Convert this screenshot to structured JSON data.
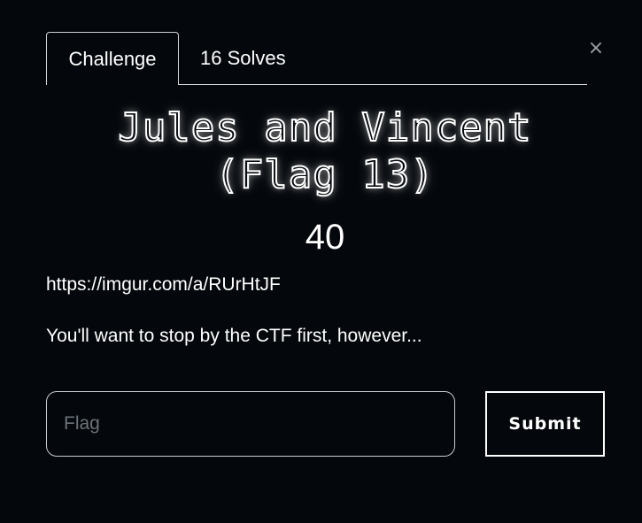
{
  "modal": {
    "close_glyph": "×",
    "tabs": [
      {
        "label": "Challenge",
        "active": true
      },
      {
        "label": "16 Solves",
        "active": false
      }
    ],
    "title_line1": "Jules and Vincent",
    "title_line2": "(Flag 13)",
    "points": "40",
    "description": {
      "link": "https://imgur.com/a/RUrHtJF",
      "text": "You'll want to stop by the CTF first, however..."
    },
    "flag_input": {
      "placeholder": "Flag",
      "value": ""
    },
    "submit_label": "Submit"
  },
  "colors": {
    "background": "#04070b",
    "text": "#ffffff",
    "border": "#d0d4d8",
    "placeholder": "#6c737a"
  }
}
